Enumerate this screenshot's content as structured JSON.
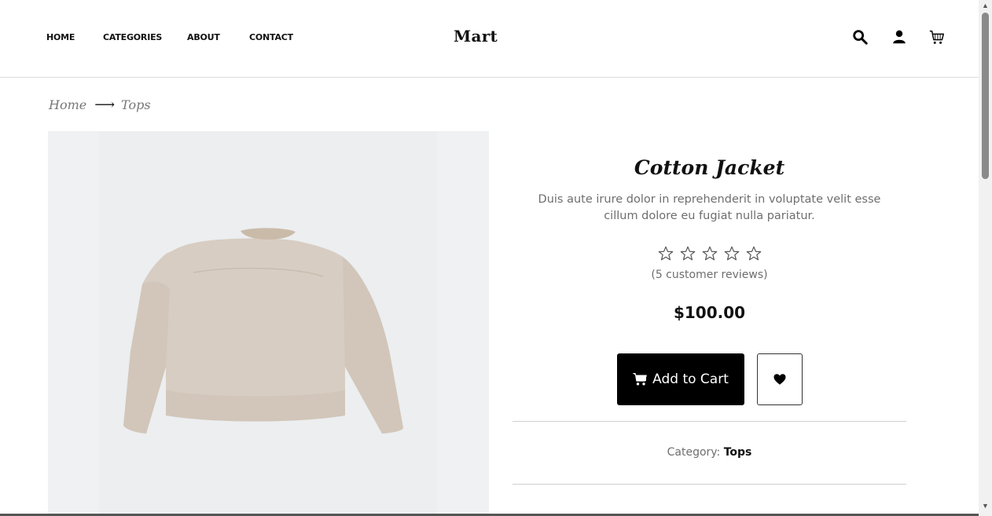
{
  "nav": {
    "home": "HOME",
    "categories": "CATEGORIES",
    "about": "ABOUT",
    "contact": "CONTACT"
  },
  "brand": {
    "logo": "Mart"
  },
  "header_icons": [
    "search-icon",
    "user-icon",
    "cart-icon"
  ],
  "breadcrumb": {
    "home": "Home",
    "separator": "⟶",
    "current": "Tops"
  },
  "product": {
    "title": "Cotton Jacket",
    "description": "Duis aute irure dolor in reprehenderit in voluptate velit esse cillum dolore eu fugiat nulla pariatur.",
    "rating": {
      "filled": 0,
      "max": 5
    },
    "reviews": "(5 customer reviews)",
    "price": "$100.00",
    "add_to_cart": "Add to Cart",
    "category_label": "Category:",
    "category_value": "Tops",
    "image_bg": "#eff1f3",
    "jacket_color": "#d8cdc2"
  },
  "colors": {
    "accent": "#000000",
    "muted_text": "#6e6e6e"
  }
}
